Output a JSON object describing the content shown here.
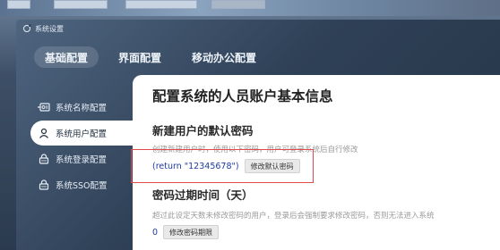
{
  "window": {
    "title": "系统设置"
  },
  "tabs": [
    {
      "label": "基础配置",
      "active": true
    },
    {
      "label": "界面配置",
      "active": false
    },
    {
      "label": "移动办公配置",
      "active": false
    }
  ],
  "sidebar": {
    "items": [
      {
        "label": "系统名称配置",
        "icon": "id-card-icon"
      },
      {
        "label": "系统用户配置",
        "icon": "user-icon",
        "active": true
      },
      {
        "label": "系统登录配置",
        "icon": "lock-icon"
      },
      {
        "label": "系统SSO配置",
        "icon": "lock-icon"
      }
    ]
  },
  "main": {
    "title": "配置系统的人员账户基本信息",
    "default_password": {
      "heading": "新建用户的默认密码",
      "desc": "创建新建用户时，使用以下密码，用户可登录系统后自行修改",
      "value": "(return \"12345678\")",
      "button": "修改默认密码"
    },
    "expiry": {
      "heading": "密码过期时间（天）",
      "desc": "超过此设定天数未修改密码的用户，登录后会强制要求修改密码，否则无法进入系统",
      "value": "0",
      "button": "修改密码期限"
    }
  },
  "colors": {
    "highlight": "#e04a4a",
    "value": "#1e3a9e"
  }
}
